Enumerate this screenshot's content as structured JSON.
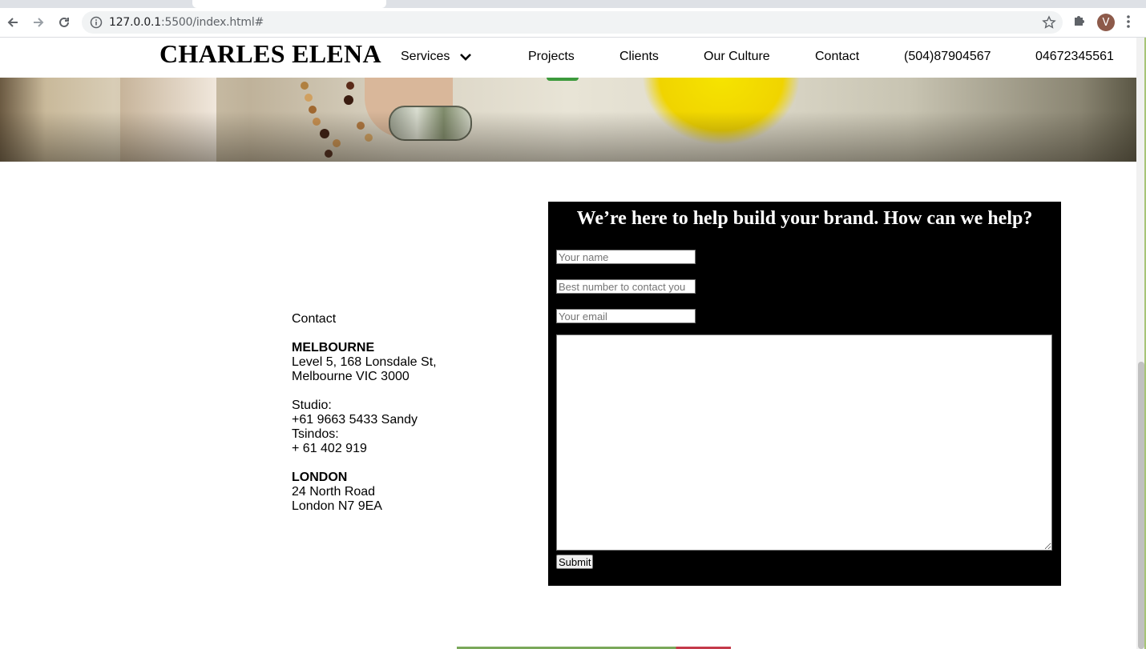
{
  "browser": {
    "url_host": "127.0.0.1",
    "url_rest": ":5500/index.html#",
    "profile_initial": "V"
  },
  "site": {
    "logo": "CHARLES ELENA",
    "nav": {
      "services": "Services",
      "projects": "Projects",
      "clients": "Clients",
      "culture": "Our Culture",
      "contact": "Contact",
      "phone1": "(504)87904567",
      "phone2": "04672345561"
    }
  },
  "contact": {
    "heading": "Contact",
    "melbourne": {
      "city": "MELBOURNE",
      "line1": "Level 5, 168 Lonsdale St,",
      "line2": "Melbourne VIC 3000"
    },
    "studio": {
      "label": "Studio:",
      "line1": "+61 9663 5433 Sandy",
      "line2": "Tsindos:",
      "line3": "+ 61 402 919"
    },
    "london": {
      "city": "LONDON",
      "line1": "24 North Road",
      "line2": "London N7 9EA"
    }
  },
  "form": {
    "title": "We’re here to help build your brand. How can we help?",
    "name_placeholder": "Your name",
    "phone_placeholder": "Best number to contact you",
    "email_placeholder": "Your email",
    "message_value": "",
    "submit": "Submit"
  }
}
